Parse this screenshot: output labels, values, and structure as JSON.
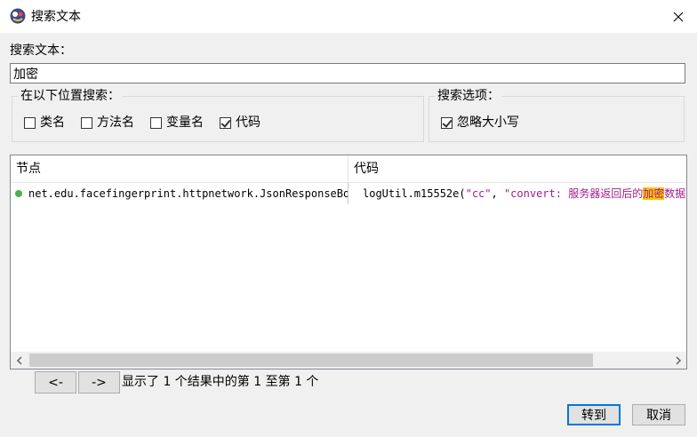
{
  "window": {
    "title": "搜索文本"
  },
  "search": {
    "label": "搜索文本：",
    "value": "加密"
  },
  "scope": {
    "title": "在以下位置搜索：",
    "options": [
      {
        "label": "类名",
        "checked": false
      },
      {
        "label": "方法名",
        "checked": false
      },
      {
        "label": "变量名",
        "checked": false
      },
      {
        "label": "代码",
        "checked": true
      }
    ]
  },
  "search_options": {
    "title": "搜索选项：",
    "options": [
      {
        "label": "忽略大小写",
        "checked": true
      }
    ]
  },
  "results": {
    "columns": [
      "节点",
      "代码"
    ],
    "rows": [
      {
        "node": "net.edu.facefingerprint.httpnetwork.JsonResponseBody",
        "code_prefix": "logUtil.m15552e(",
        "code_arg1": "\"cc\"",
        "code_comma": ", ",
        "code_str_before": "\"convert: 服务器返回后的",
        "code_match": "加密",
        "code_str_after": "数据",
        "node_status_color": "#4caf50"
      }
    ]
  },
  "colors": {
    "string": "#a31b8f",
    "match_highlight": "#ffc000",
    "primary_border": "#0078d7"
  },
  "nav": {
    "prev_label": "<-",
    "next_label": "->"
  },
  "status_text": "显示了 1 个结果中的第 1 至第 1 个",
  "buttons": {
    "goto": "转到",
    "cancel": "取消"
  },
  "icons": {
    "close": "close-icon",
    "app": "app-logo-icon",
    "scroll_left": "scroll-left-icon",
    "scroll_right": "scroll-right-icon"
  }
}
